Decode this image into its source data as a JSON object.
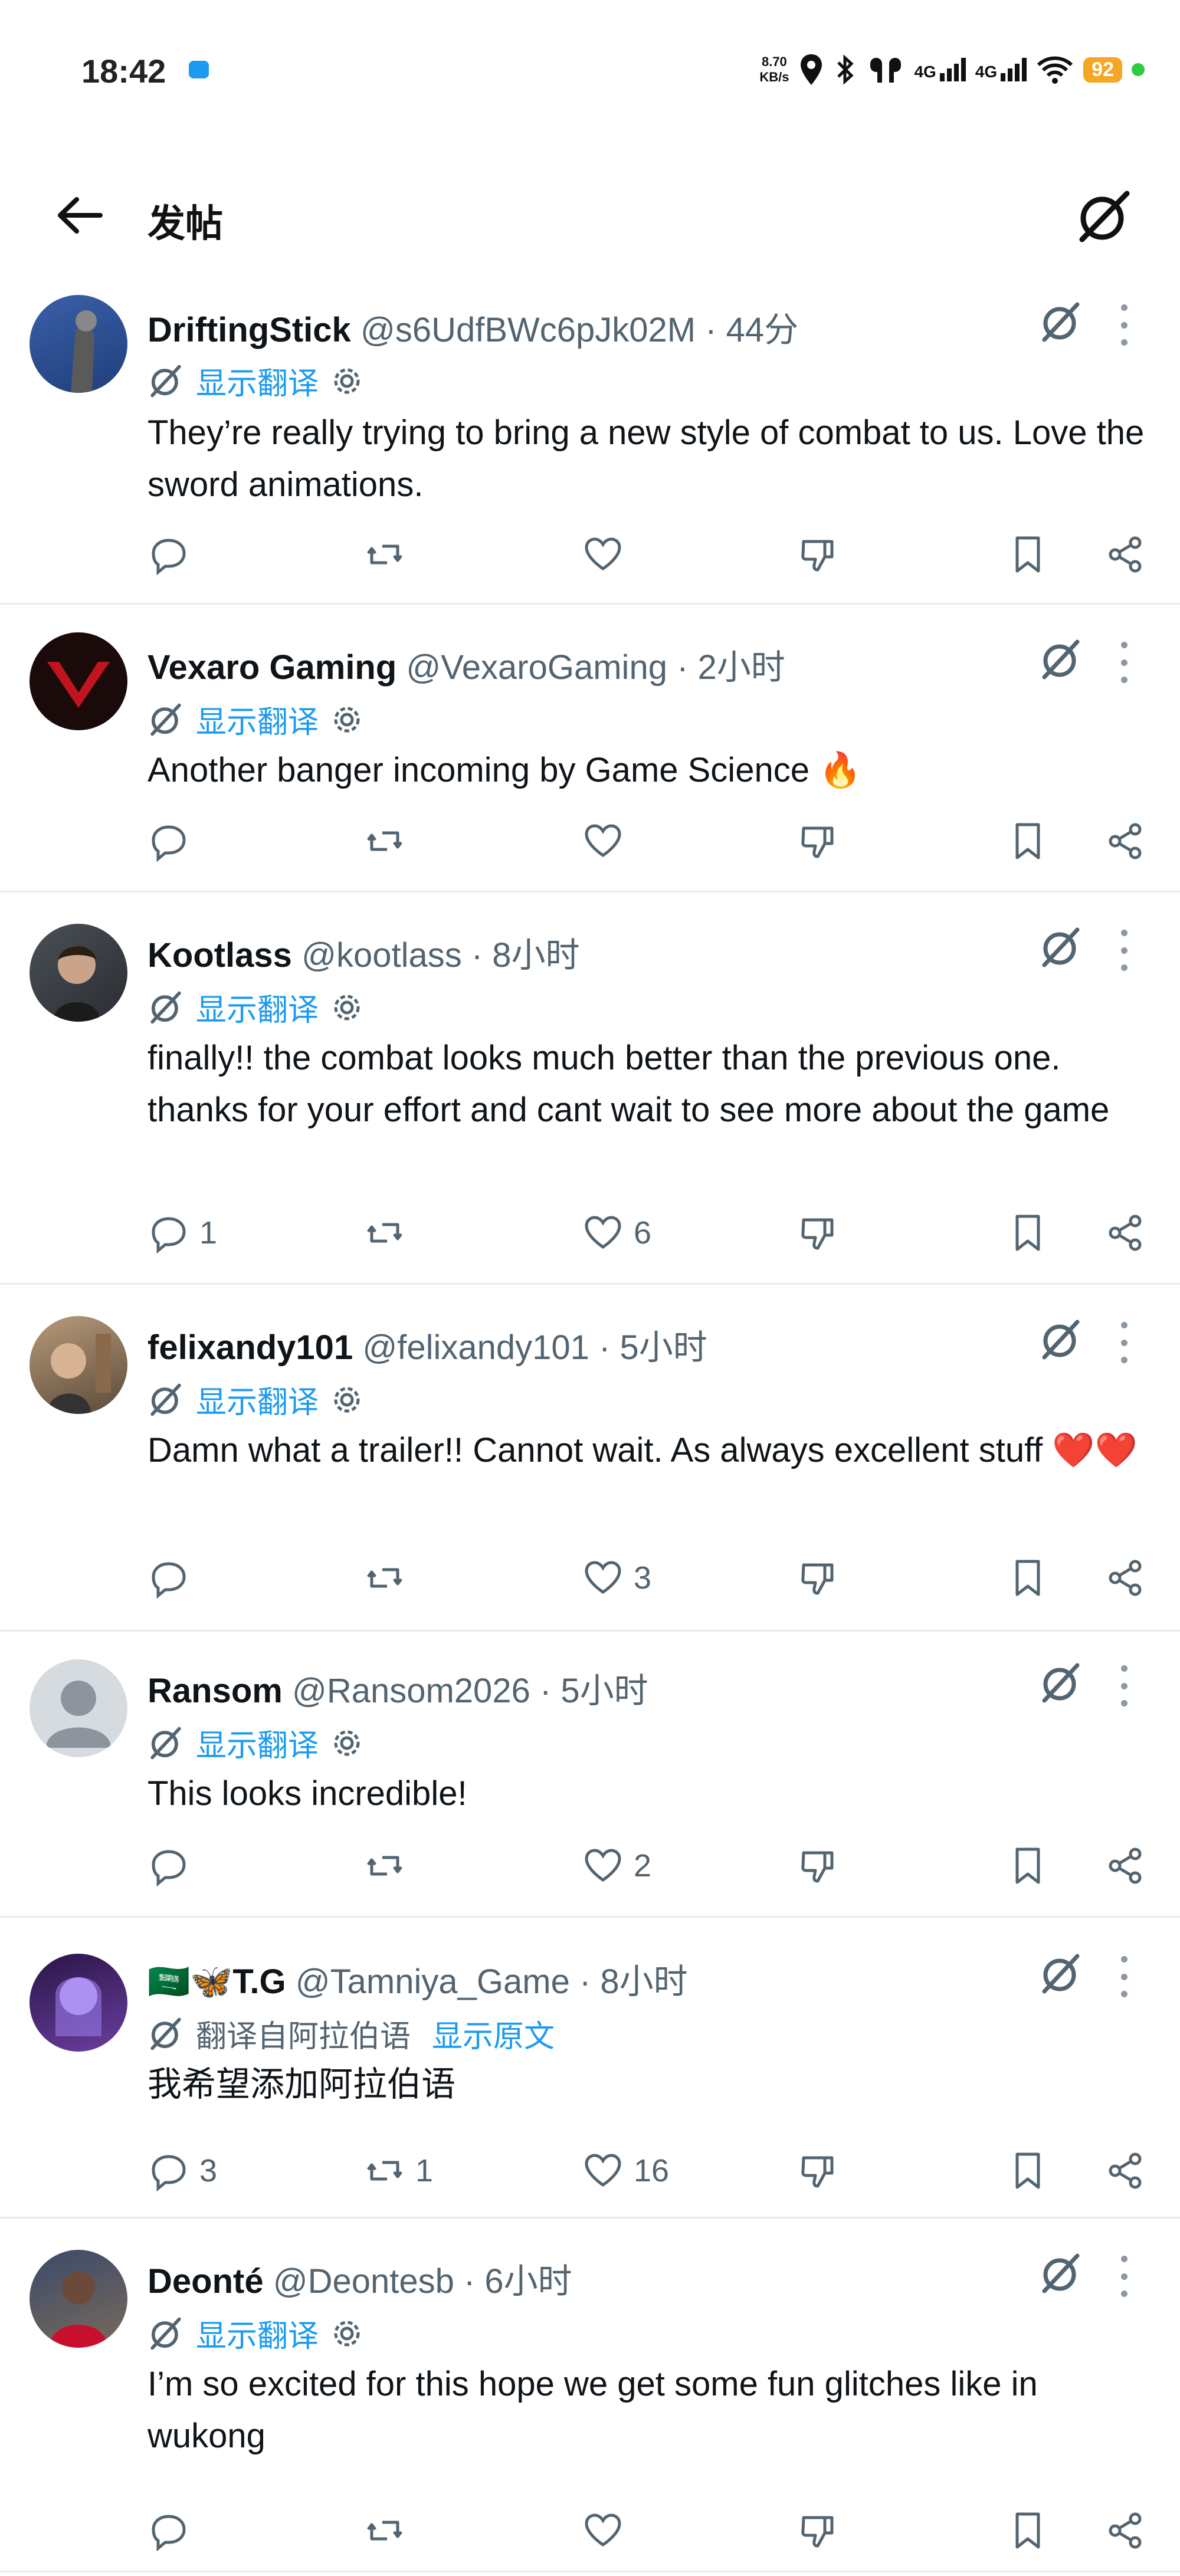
{
  "status_bar": {
    "time": "18:42",
    "net_speed_value": "8.70",
    "net_speed_unit": "KB/s",
    "signal1": "4G",
    "signal2": "4G",
    "battery": "92"
  },
  "header": {
    "title": "发帖",
    "back_icon": "arrow-left-icon",
    "grok_icon": "grok-icon"
  },
  "tweets": [
    {
      "name": "DriftingStick",
      "handle": "@s6UdfBWc6pJk02M",
      "time": "· 44分",
      "translate": "显示翻译",
      "text": "They’re really trying to bring a new style of combat to us. Love the sword animations.",
      "replies": "",
      "retweets": "",
      "likes": ""
    },
    {
      "name": "Vexaro Gaming",
      "handle": "@VexaroGaming",
      "time": "· 2小时",
      "translate": "显示翻译",
      "text": "Another banger incoming by Game Science 🔥",
      "replies": "",
      "retweets": "",
      "likes": ""
    },
    {
      "name": "Kootlass",
      "handle": "@kootlass",
      "time": "· 8小时",
      "translate": "显示翻译",
      "text": "finally!! the combat looks much better than the previous one. thanks for your effort and cant wait to see more about the game",
      "replies": "1",
      "retweets": "",
      "likes": "6"
    },
    {
      "name": "felixandy101",
      "handle": "@felixandy101",
      "time": "· 5小时",
      "translate": "显示翻译",
      "text": "Damn what a trailer!! Cannot wait. As always excellent stuff ❤️❤️",
      "replies": "",
      "retweets": "",
      "likes": "3"
    },
    {
      "name": "Ransom",
      "handle": "@Ransom2026",
      "time": "· 5小时",
      "translate": "显示翻译",
      "text": "This looks incredible!",
      "replies": "",
      "retweets": "",
      "likes": "2"
    },
    {
      "name": "🇸🇦🦋T.G",
      "handle": "@Tamniya_Game",
      "time": "· 8小时",
      "translated_from": "翻译自阿拉伯语",
      "show_original": "显示原文",
      "text": "我希望添加阿拉伯语",
      "replies": "3",
      "retweets": "1",
      "likes": "16"
    },
    {
      "name": "Deonté",
      "handle": "@Deontesb",
      "time": "· 6小时",
      "translate": "显示翻译",
      "text": "I’m so excited for this hope we get some fun glitches like in wukong",
      "replies": "",
      "retweets": "",
      "likes": ""
    }
  ],
  "icons": {
    "reply": "reply-icon",
    "retweet": "retweet-icon",
    "like": "heart-icon",
    "dislike": "downvote-icon",
    "bookmark": "bookmark-icon",
    "share": "share-icon",
    "translate": "grok-translate-icon",
    "settings": "gear-icon",
    "more": "more-icon"
  },
  "colors": {
    "link": "#1d9bf0",
    "secondary_text": "#536471",
    "divider": "#e6ecf0",
    "battery": "#f5a623"
  }
}
